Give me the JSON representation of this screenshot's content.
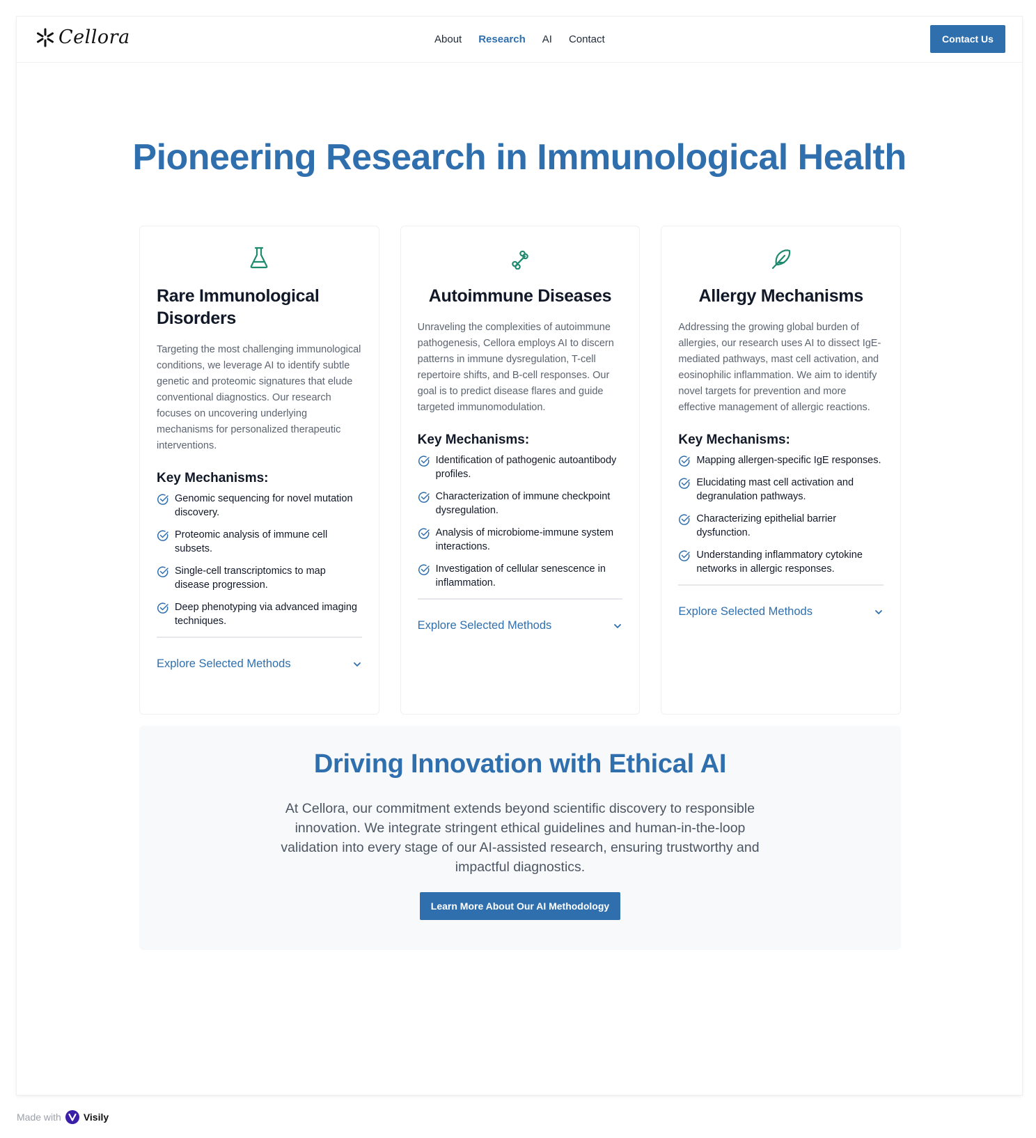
{
  "header": {
    "brand": "Cellora",
    "logo_icon": "asterisk-flower-icon",
    "nav": [
      {
        "label": "About",
        "active": false
      },
      {
        "label": "Research",
        "active": true
      },
      {
        "label": "AI",
        "active": false
      },
      {
        "label": "Contact",
        "active": false
      }
    ],
    "contact_button": "Contact Us"
  },
  "hero": {
    "title": "Pioneering Research in Immunological Health"
  },
  "colors": {
    "accent": "#2f6fae",
    "icon_green": "#1e8a6e",
    "ethics_bg": "#f8f9fa"
  },
  "cards": [
    {
      "icon": "flask-icon",
      "title": "Rare Immunological Disorders",
      "description": "Targeting the most challenging immunological conditions, we leverage AI to identify subtle genetic and proteomic signatures that elude conventional diagnostics. Our research focuses on uncovering underlying mechanisms for personalized therapeutic interventions.",
      "mechanisms_title": "Key Mechanisms:",
      "mechanisms": [
        "Genomic sequencing for novel mutation discovery.",
        "Proteomic analysis of immune cell subsets.",
        "Single-cell transcriptomics to map disease progression.",
        "Deep phenotyping via advanced imaging techniques."
      ],
      "explore": "Explore Selected Methods"
    },
    {
      "icon": "bone-icon",
      "title": "Autoimmune Diseases",
      "description": "Unraveling the complexities of autoimmune pathogenesis, Cellora employs AI to discern patterns in immune dysregulation, T-cell repertoire shifts, and B-cell responses. Our goal is to predict disease flares and guide targeted immunomodulation.",
      "mechanisms_title": "Key Mechanisms:",
      "mechanisms": [
        "Identification of pathogenic autoantibody profiles.",
        "Characterization of immune checkpoint dysregulation.",
        "Analysis of microbiome-immune system interactions.",
        "Investigation of cellular senescence in inflammation."
      ],
      "explore": "Explore Selected Methods"
    },
    {
      "icon": "feather-icon",
      "title": "Allergy Mechanisms",
      "description": "Addressing the growing global burden of allergies, our research uses AI to dissect IgE-mediated pathways, mast cell activation, and eosinophilic inflammation. We aim to identify novel targets for prevention and more effective management of allergic reactions.",
      "mechanisms_title": "Key Mechanisms:",
      "mechanisms": [
        "Mapping allergen-specific IgE responses.",
        "Elucidating mast cell activation and degranulation pathways.",
        "Characterizing epithelial barrier dysfunction.",
        "Understanding inflammatory cytokine networks in allergic responses."
      ],
      "explore": "Explore Selected Methods"
    }
  ],
  "ethics": {
    "title": "Driving Innovation with Ethical AI",
    "text": "At Cellora, our commitment extends beyond scientific discovery to responsible innovation. We integrate stringent ethical guidelines and human-in-the-loop validation into every stage of our AI-assisted research, ensuring trustworthy and impactful diagnostics.",
    "button": "Learn More About Our AI Methodology"
  },
  "footer": {
    "made_with": "Made with",
    "brand": "Visily"
  }
}
